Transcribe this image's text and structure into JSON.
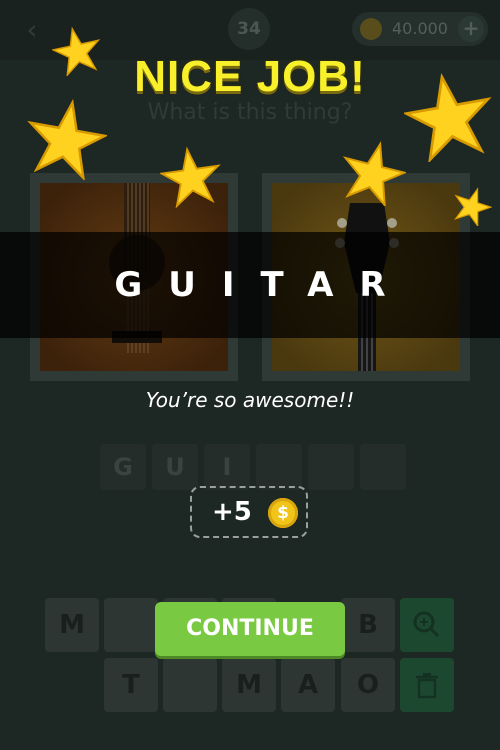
{
  "header": {
    "back_icon": "chevron-left-icon",
    "level": "34",
    "coins": "40.000",
    "coin_icon": "coin-icon",
    "add_icon": "plus-icon"
  },
  "question": "What is this thing?",
  "answer_slots": [
    "G",
    "U",
    "I",
    "",
    "",
    ""
  ],
  "keyboard": {
    "row1": [
      "M",
      "",
      "",
      "",
      "B"
    ],
    "row2": [
      "T",
      "",
      "M",
      "A",
      "O"
    ],
    "hint_icon": "zoom-in-icon",
    "delete_icon": "trash-icon"
  },
  "overlay": {
    "title": "NICE JOB!",
    "answer": "GUITAR",
    "praise": "You’re so awesome!!",
    "reward": "+5",
    "reward_icon": "dollar-coin-icon",
    "continue_label": "CONTINUE"
  },
  "colors": {
    "title_yellow": "#f7f02a",
    "continue_green": "#7ac943",
    "coin_gold": "#f0c419",
    "star_gold": "#ffd21f"
  }
}
